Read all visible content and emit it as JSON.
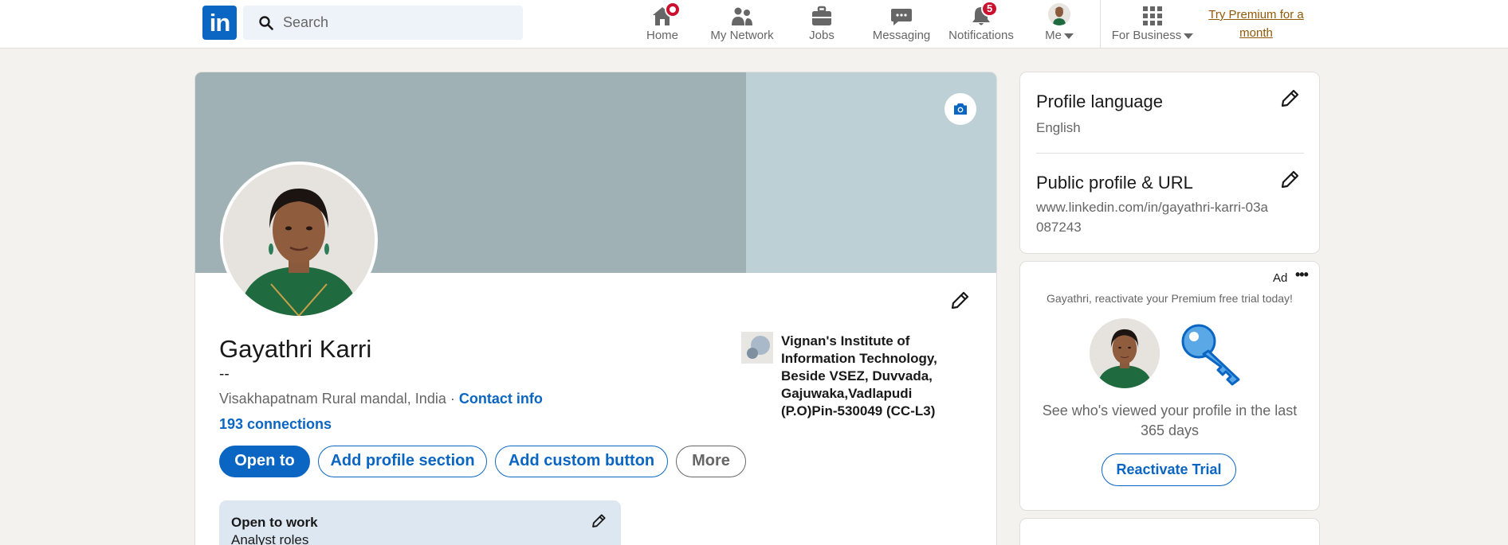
{
  "nav": {
    "logo_text": "in",
    "search_placeholder": "Search",
    "items": [
      {
        "label": "Home",
        "badge": ""
      },
      {
        "label": "My Network",
        "badge": ""
      },
      {
        "label": "Jobs",
        "badge": ""
      },
      {
        "label": "Messaging",
        "badge": ""
      },
      {
        "label": "Notifications",
        "badge": "5"
      },
      {
        "label": "Me",
        "badge": ""
      },
      {
        "label": "For Business",
        "badge": ""
      }
    ],
    "premium_link": "Try Premium for a month"
  },
  "profile": {
    "name": "Gayathri Karri",
    "headline": "--",
    "location": "Visakhapatnam Rural mandal, India",
    "separator": " · ",
    "contact_info": "Contact info",
    "connections": "193 connections",
    "education": "Vignan's Institute of Information Technology, Beside VSEZ, Duvvada, Gajuwaka,Vadlapudi (P.O)Pin-530049 (CC-L3)",
    "buttons": {
      "open_to": "Open to",
      "add_section": "Add profile section",
      "add_custom": "Add custom button",
      "more": "More"
    },
    "open_to_work": {
      "title": "Open to work",
      "subtitle": "Analyst roles"
    }
  },
  "sidebar": {
    "profile_language": {
      "title": "Profile language",
      "value": "English"
    },
    "public_profile": {
      "title": "Public profile & URL",
      "value": "www.linkedin.com/in/gayathri-karri-03a087243"
    },
    "ad": {
      "label": "Ad",
      "dots": "•••",
      "tagline": "Gayathri, reactivate your Premium free trial today!",
      "text": "See who's viewed your profile in the last 365 days",
      "button": "Reactivate Trial"
    }
  },
  "colors": {
    "brand": "#0a66c2",
    "page_bg": "#f4f2ee",
    "notification_badge": "#cb112d",
    "premium_link": "#915907",
    "open_to_work_bg": "#dde7f1"
  },
  "icons": [
    "search-icon",
    "home-icon",
    "network-icon",
    "jobs-icon",
    "messaging-icon",
    "notifications-icon",
    "grid-icon",
    "camera-icon",
    "pencil-icon",
    "key-icon"
  ]
}
